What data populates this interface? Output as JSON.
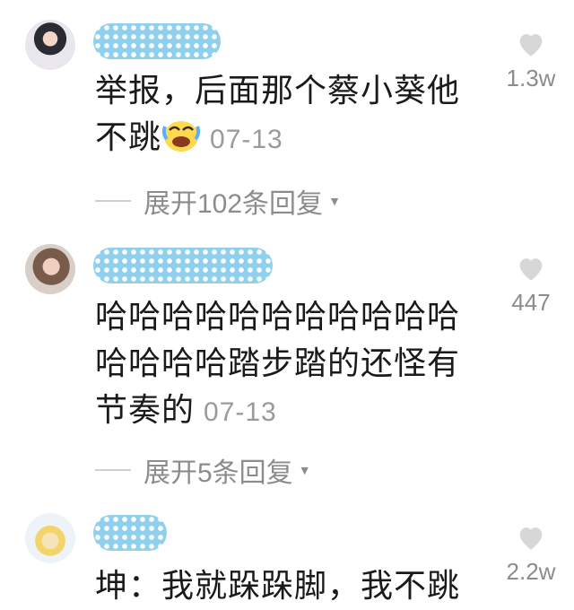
{
  "comments": [
    {
      "text": "举报，后面那个蔡小葵他不跳",
      "emoji": "crying-laughing-emoji",
      "date": "07-13",
      "likes": "1.3w",
      "replies": "展开102条回复"
    },
    {
      "text": "哈哈哈哈哈哈哈哈哈哈哈哈哈哈哈踏步踏的还怪有节奏的",
      "date": "07-13",
      "likes": "447",
      "replies": "展开5条回复"
    },
    {
      "text": "坤：我就跺跺脚，我不跳",
      "likes": "2.2w"
    }
  ],
  "icons": {
    "like": "heart-icon",
    "expand": "caret-down-icon"
  },
  "colors": {
    "text": "#1a1a1a",
    "meta": "#8c8c8c",
    "nickname_mask": "#8fd0ef"
  }
}
